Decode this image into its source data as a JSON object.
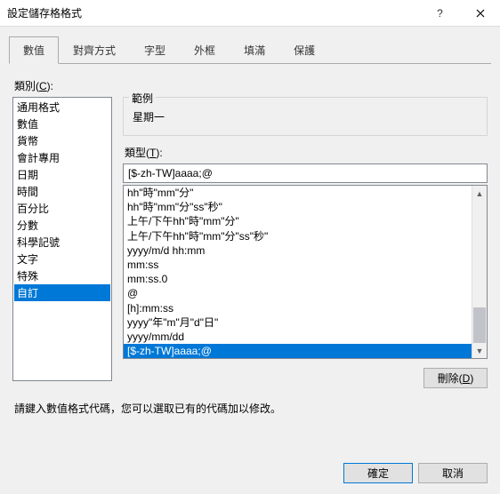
{
  "title": "設定儲存格格式",
  "tabs": [
    "數值",
    "對齊方式",
    "字型",
    "外框",
    "填滿",
    "保護"
  ],
  "active_tab": 0,
  "category_label_pre": "類別(",
  "category_label_u": "C",
  "category_label_post": "):",
  "categories": [
    "通用格式",
    "數值",
    "貨幣",
    "會計專用",
    "日期",
    "時間",
    "百分比",
    "分數",
    "科學記號",
    "文字",
    "特殊",
    "自訂"
  ],
  "category_selected": 11,
  "preview": {
    "label": "範例",
    "value": "星期一"
  },
  "type_label_pre": "類型(",
  "type_label_u": "T",
  "type_label_post": "):",
  "type_value": "[$-zh-TW]aaaa;@",
  "type_options": [
    "hh\"時\"mm\"分\"",
    "hh\"時\"mm\"分\"ss\"秒\"",
    "上午/下午hh\"時\"mm\"分\"",
    "上午/下午hh\"時\"mm\"分\"ss\"秒\"",
    "yyyy/m/d hh:mm",
    "mm:ss",
    "mm:ss.0",
    "@",
    "[h]:mm:ss",
    "yyyy\"年\"m\"月\"d\"日\"",
    "yyyy/mm/dd",
    "[$-zh-TW]aaaa;@"
  ],
  "type_selected": 11,
  "delete_pre": "刪除(",
  "delete_u": "D",
  "delete_post": ")",
  "hint": "請鍵入數值格式代碼，您可以選取已有的代碼加以修改。",
  "ok": "確定",
  "cancel": "取消"
}
